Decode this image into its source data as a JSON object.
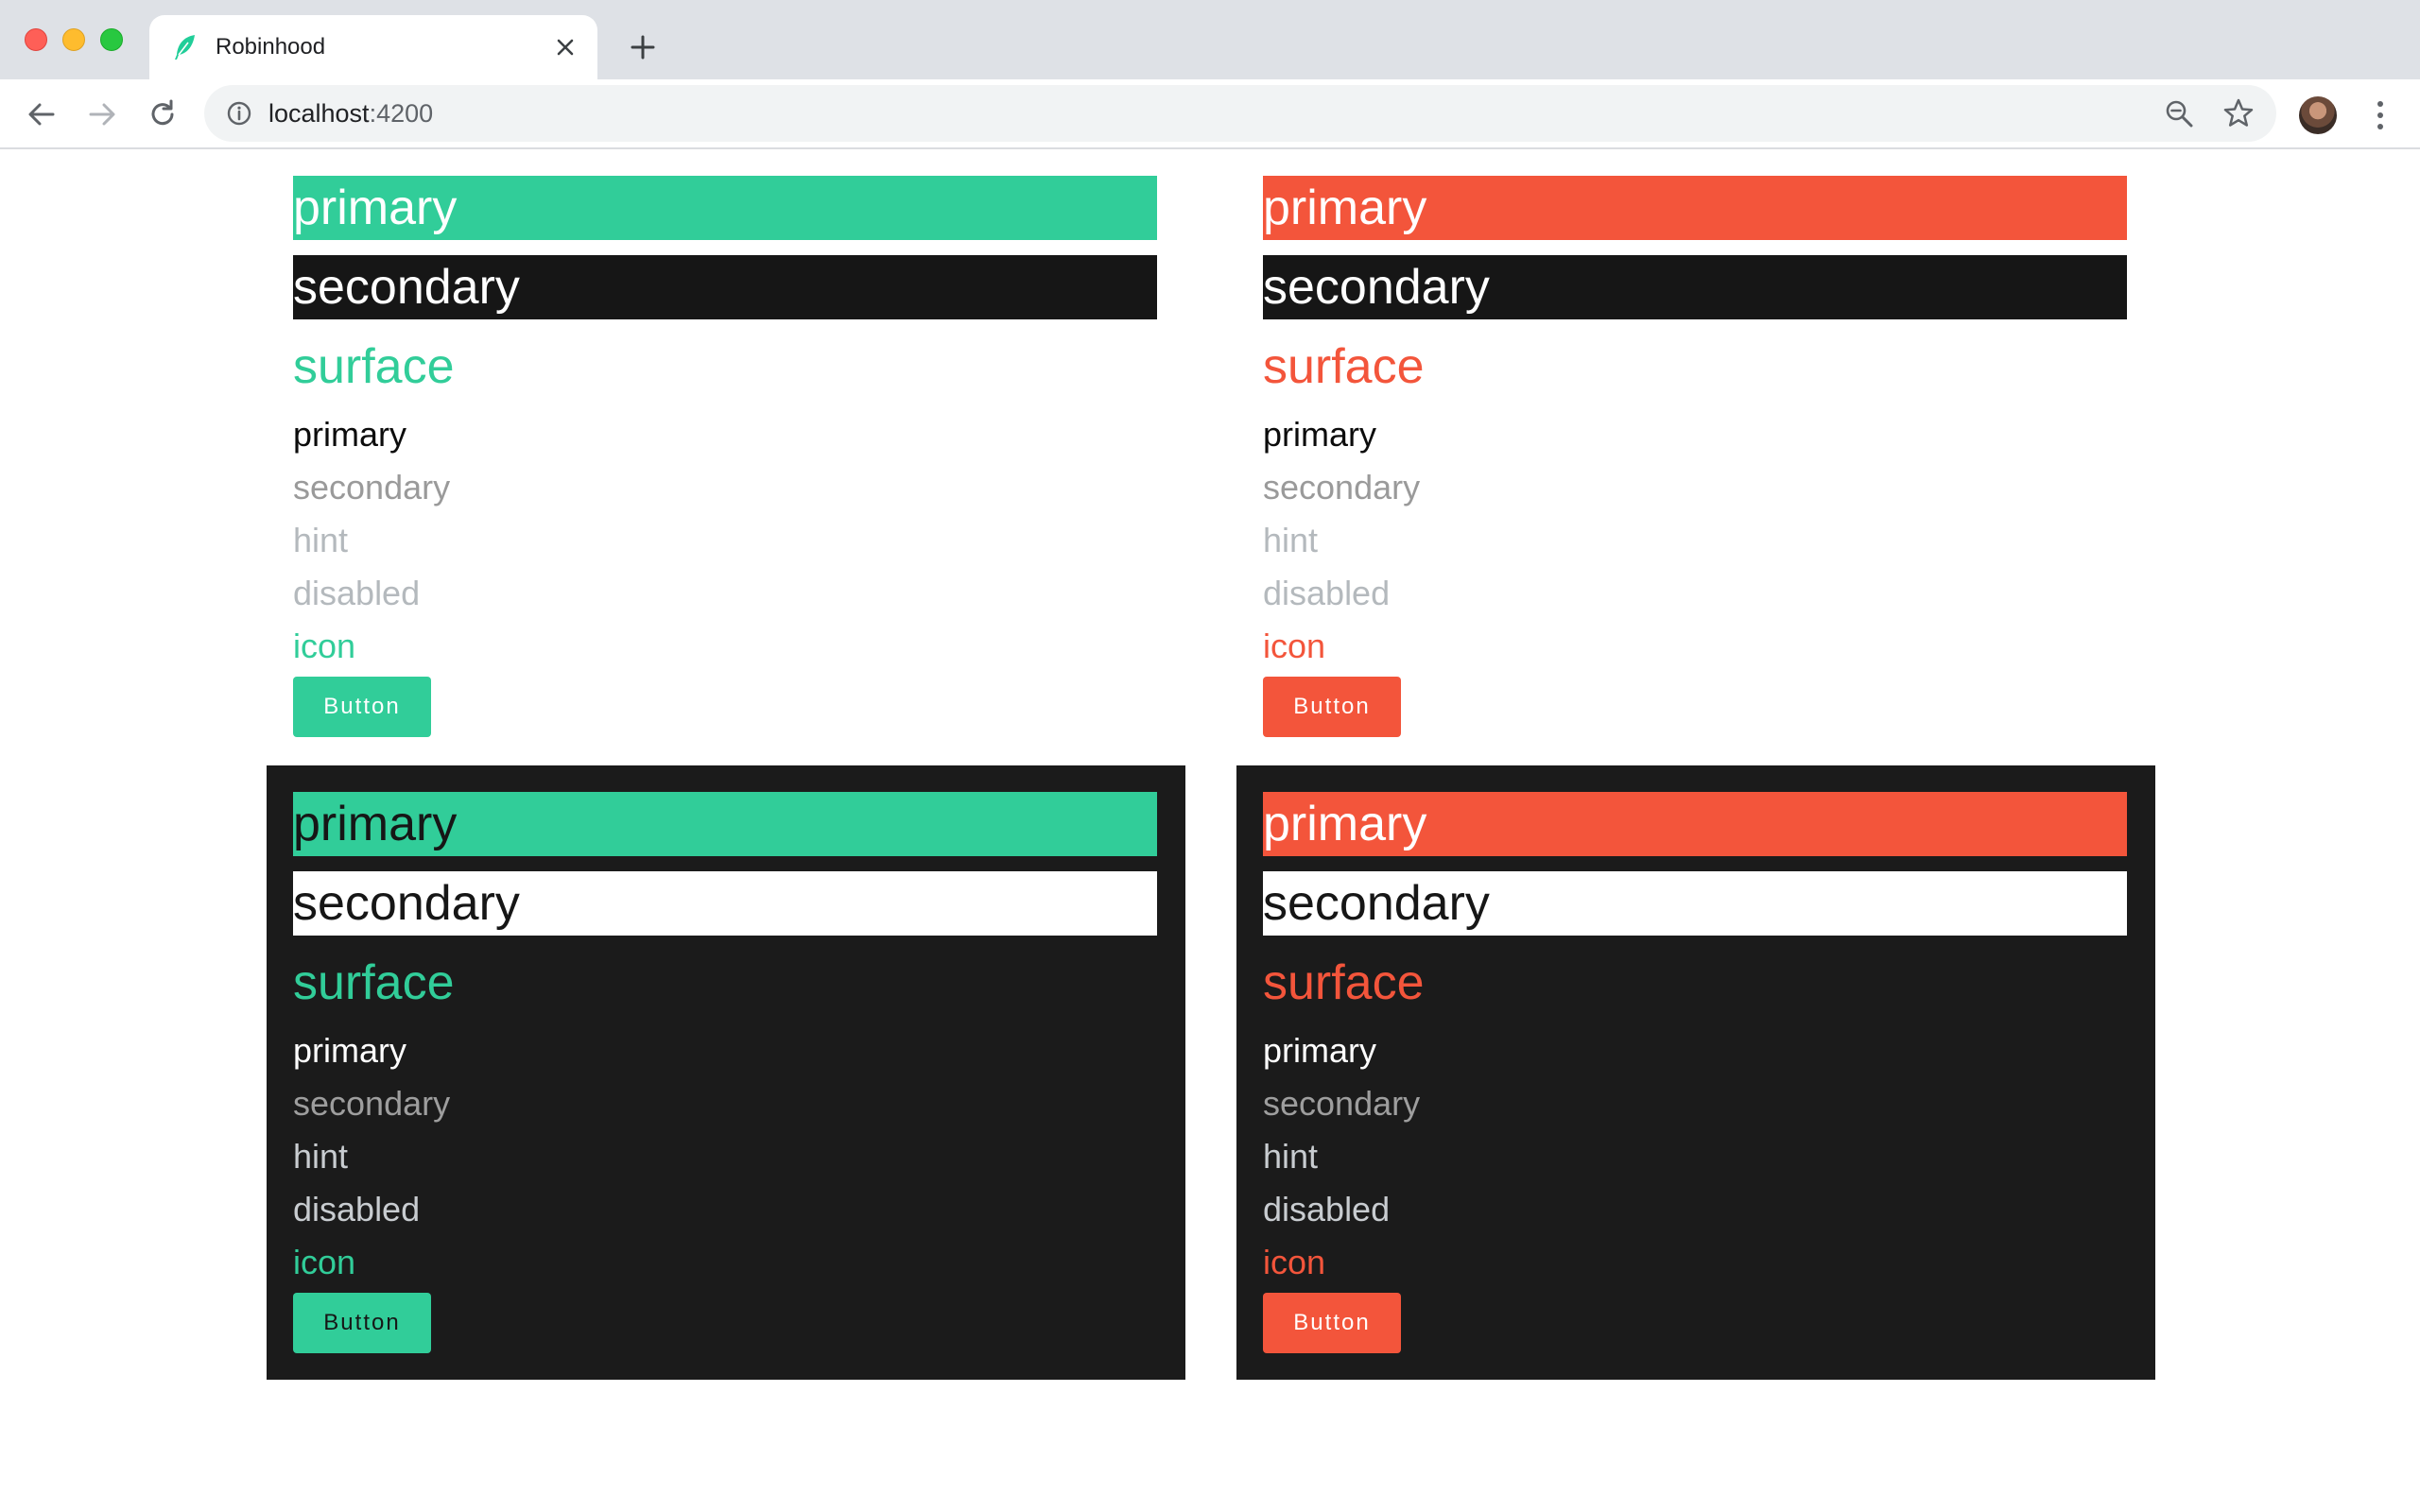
{
  "browser": {
    "tab_title": "Robinhood",
    "url_host": "localhost",
    "url_port": ":4200",
    "icons": {
      "favicon": "feather-icon",
      "tab_close": "close-icon",
      "new_tab": "plus-icon",
      "back": "arrow-left-icon",
      "forward": "arrow-right-icon",
      "reload": "reload-icon",
      "site_info": "info-icon",
      "zoom": "zoom-out-icon",
      "bookmark": "star-icon",
      "menu": "more-vertical-icon"
    }
  },
  "colors": {
    "green": "#31cd99",
    "orange": "#f3553b",
    "dark_surface": "#1b1b1b",
    "light_surface": "#ffffff"
  },
  "panels": [
    {
      "id": "light-green",
      "theme": "light",
      "accent": "#31cd99",
      "bar_primary": "primary",
      "bar_secondary": "secondary",
      "surface": "surface",
      "text_primary": "primary",
      "text_secondary": "secondary",
      "text_hint": "hint",
      "text_disabled": "disabled",
      "text_icon": "icon",
      "button_label": "Button"
    },
    {
      "id": "light-orange",
      "theme": "light",
      "accent": "#f3553b",
      "bar_primary": "primary",
      "bar_secondary": "secondary",
      "surface": "surface",
      "text_primary": "primary",
      "text_secondary": "secondary",
      "text_hint": "hint",
      "text_disabled": "disabled",
      "text_icon": "icon",
      "button_label": "Button"
    },
    {
      "id": "dark-green",
      "theme": "dark",
      "accent": "#31cd99",
      "bar_primary": "primary",
      "bar_secondary": "secondary",
      "surface": "surface",
      "text_primary": "primary",
      "text_secondary": "secondary",
      "text_hint": "hint",
      "text_disabled": "disabled",
      "text_icon": "icon",
      "button_label": "Button"
    },
    {
      "id": "dark-orange",
      "theme": "dark",
      "accent": "#f3553b",
      "bar_primary": "primary",
      "bar_secondary": "secondary",
      "surface": "surface",
      "text_primary": "primary",
      "text_secondary": "secondary",
      "text_hint": "hint",
      "text_disabled": "disabled",
      "text_icon": "icon",
      "button_label": "Button"
    }
  ]
}
